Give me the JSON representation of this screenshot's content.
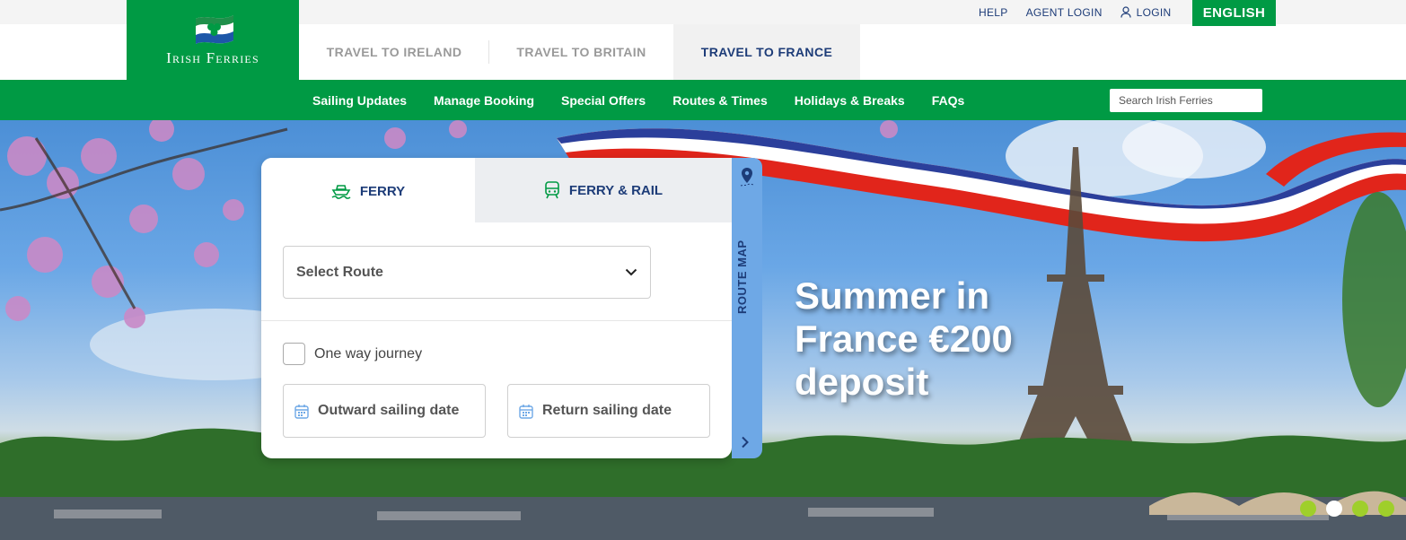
{
  "utility": {
    "help": "HELP",
    "agent_login": "AGENT LOGIN",
    "login": "LOGIN",
    "language": "ENGLISH"
  },
  "logo": {
    "text": "Irish Ferries"
  },
  "travel_tabs": [
    {
      "label": "TRAVEL TO IRELAND"
    },
    {
      "label": "TRAVEL TO BRITAIN"
    },
    {
      "label": "TRAVEL TO FRANCE",
      "active": true
    }
  ],
  "nav": {
    "items": [
      {
        "label": "Sailing Updates"
      },
      {
        "label": "Manage Booking"
      },
      {
        "label": "Special Offers"
      },
      {
        "label": "Routes & Times"
      },
      {
        "label": "Holidays & Breaks"
      },
      {
        "label": "FAQs"
      }
    ],
    "search_placeholder": "Search Irish Ferries"
  },
  "booking": {
    "tabs": [
      {
        "label": "FERRY",
        "icon": "ferry-icon",
        "active": true
      },
      {
        "label": "FERRY & RAIL",
        "icon": "train-icon",
        "active": false
      }
    ],
    "route_select": "Select Route",
    "one_way_label": "One way journey",
    "one_way_checked": false,
    "outward_date": "Outward sailing date",
    "return_date": "Return sailing date",
    "route_map_label": "ROUTE MAP"
  },
  "hero": {
    "title": "Summer in France €200 deposit",
    "carousel_active_index": 1,
    "carousel_count": 4
  },
  "colors": {
    "brand_green": "#009a44",
    "navy": "#1d3c78",
    "route_map_blue": "#6ea8e6",
    "dot_green": "#9fcf2b"
  }
}
